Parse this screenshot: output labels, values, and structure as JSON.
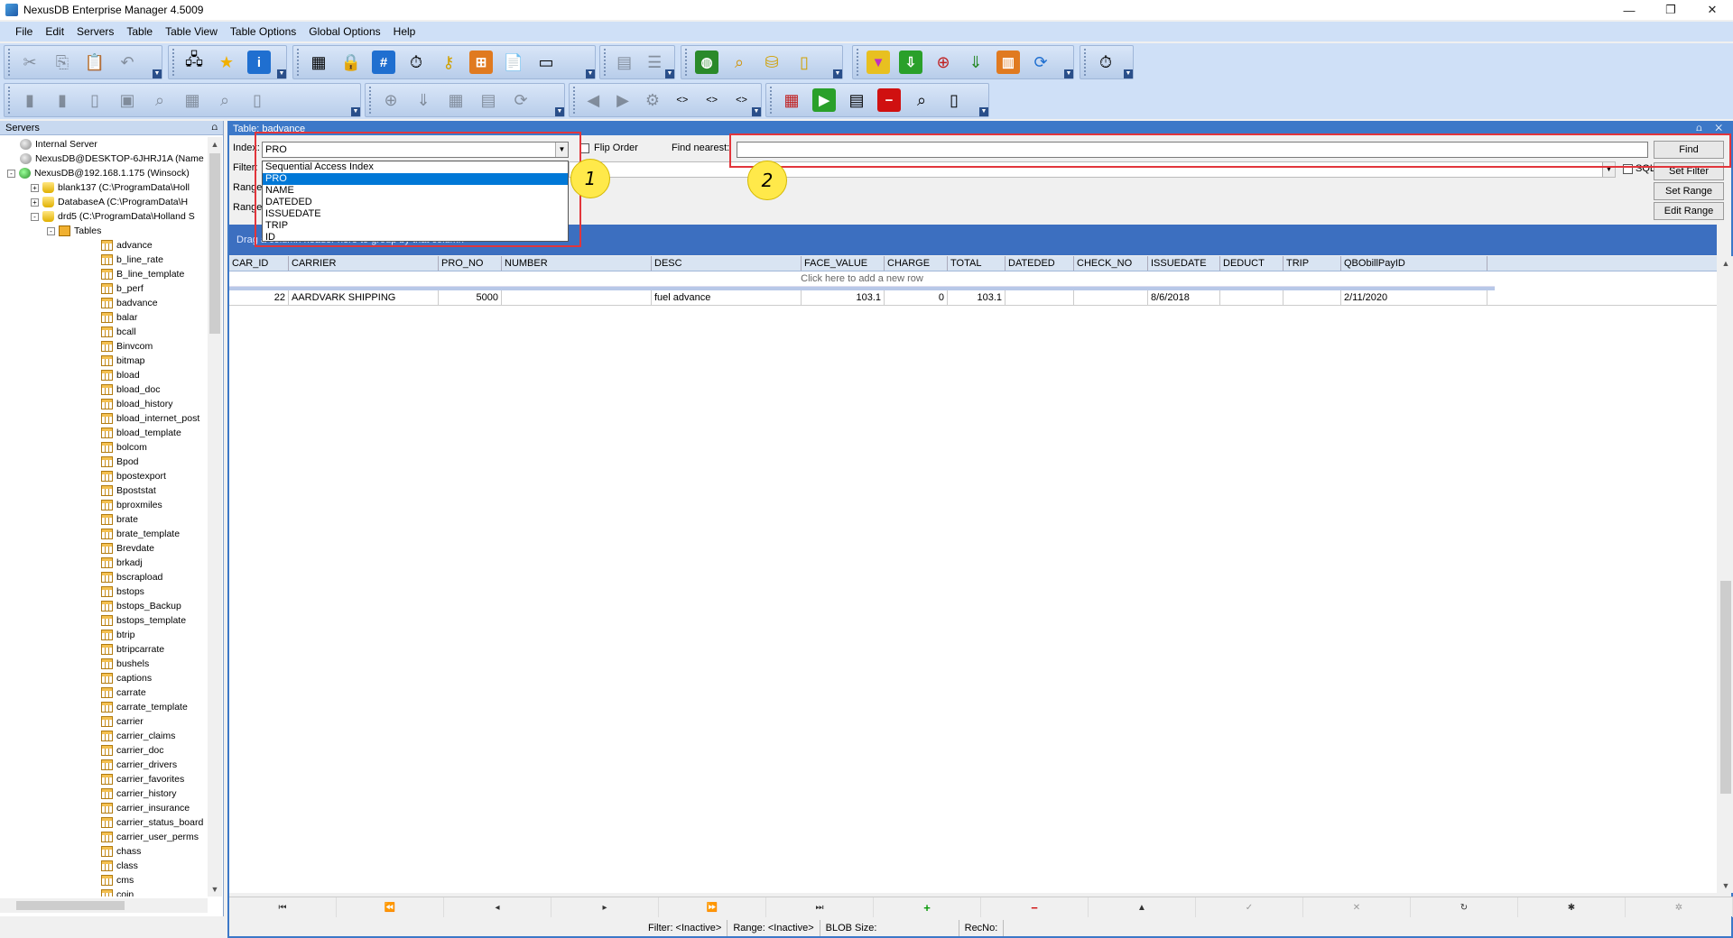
{
  "window": {
    "title": "NexusDB Enterprise Manager 4.5009",
    "minimize": "—",
    "maximize": "❐",
    "close": "✕"
  },
  "menu": [
    {
      "label": "File"
    },
    {
      "label": "Edit"
    },
    {
      "label": "Servers"
    },
    {
      "label": "Table"
    },
    {
      "label": "Table View"
    },
    {
      "label": "Table Options"
    },
    {
      "label": "Global Options"
    },
    {
      "label": "Help"
    }
  ],
  "servers_panel": {
    "title": "Servers",
    "pin": "⩍",
    "nodes": [
      {
        "label": "Internal Server",
        "icon": "server-icon",
        "level": 0
      },
      {
        "label": "NexusDB@DESKTOP-6JHRJ1A (Name",
        "icon": "server-icon",
        "level": 0
      },
      {
        "label": "NexusDB@192.168.1.175 (Winsock)",
        "icon": "server-connected-icon",
        "level": 0,
        "exp": "-"
      },
      {
        "label": "blank137 (C:\\ProgramData\\Holl",
        "icon": "database-icon",
        "level": 1,
        "exp": "+"
      },
      {
        "label": "DatabaseA (C:\\ProgramData\\H",
        "icon": "database-icon",
        "level": 1,
        "exp": "+"
      },
      {
        "label": "drd5 (C:\\ProgramData\\Holland S",
        "icon": "database-icon",
        "level": 1,
        "exp": "-"
      },
      {
        "label": "Tables",
        "icon": "tables-folder-icon",
        "level": 2,
        "exp": "-"
      }
    ],
    "tables": [
      "advance",
      "b_line_rate",
      "B_line_template",
      "b_perf",
      "badvance",
      "balar",
      "bcall",
      "Binvcom",
      "bitmap",
      "bload",
      "bload_doc",
      "bload_history",
      "bload_internet_post",
      "bload_template",
      "bolcom",
      "Bpod",
      "bpostexport",
      "Bpoststat",
      "bproxmiles",
      "brate",
      "brate_template",
      "Brevdate",
      "brkadj",
      "bscrapload",
      "bstops",
      "bstops_Backup",
      "bstops_template",
      "btrip",
      "btripcarrate",
      "bushels",
      "captions",
      "carrate",
      "carrate_template",
      "carrier",
      "carrier_claims",
      "carrier_doc",
      "carrier_drivers",
      "carrier_favorites",
      "carrier_history",
      "carrier_insurance",
      "carrier_status_board",
      "carrier_user_perms",
      "chass",
      "class",
      "cms",
      "coin"
    ]
  },
  "table_window": {
    "title": "Table: badvance",
    "wbtns": "⩍ ✕",
    "index_label": "Index:",
    "index_value": "PRO",
    "index_options": [
      "Sequential Access Index",
      "PRO",
      "NAME",
      "DATEDED",
      "ISSUEDATE",
      "TRIP",
      "ID"
    ],
    "flip_order_label": "Flip Order",
    "find_nearest_label": "Find nearest:",
    "find_value": "",
    "find_button": "Find",
    "filter_label": "Filter:",
    "sql_filter_label": "SQL Filter",
    "set_filter_button": "Set Filter",
    "range_label_1": "Range",
    "range_label_2": "Range",
    "set_range_button": "Set Range",
    "edit_range_button": "Edit Range",
    "group_band_text": "Drag a column header here to group by that column",
    "add_row_text": "Click here to add a new row",
    "columns": [
      "CAR_ID",
      "CARRIER",
      "PRO_NO",
      "NUMBER",
      "DESC",
      "FACE_VALUE",
      "CHARGE",
      "TOTAL",
      "DATEDED",
      "CHECK_NO",
      "ISSUEDATE",
      "DEDUCT",
      "TRIP",
      "QBObillPayID"
    ],
    "rows": [
      [
        "22",
        "AARDVARK SHIPPING",
        "5000",
        "",
        "fuel advance",
        "103.1",
        "0",
        "103.1",
        "",
        "",
        "8/6/2018",
        "",
        "",
        "2/11/2020"
      ]
    ],
    "nav": [
      {
        "name": "nav-first-button",
        "glyph": "⏮"
      },
      {
        "name": "nav-prior-page-button",
        "glyph": "⏪"
      },
      {
        "name": "nav-prior-button",
        "glyph": "◂"
      },
      {
        "name": "nav-next-button",
        "glyph": "▸"
      },
      {
        "name": "nav-next-page-button",
        "glyph": "⏩"
      },
      {
        "name": "nav-last-button",
        "glyph": "⏭"
      },
      {
        "name": "nav-insert-button",
        "glyph": "+"
      },
      {
        "name": "nav-delete-button",
        "glyph": "−"
      },
      {
        "name": "nav-edit-button",
        "glyph": "▲"
      },
      {
        "name": "nav-post-button",
        "glyph": "✓"
      },
      {
        "name": "nav-cancel-button",
        "glyph": "✕"
      },
      {
        "name": "nav-refresh-button",
        "glyph": "↻"
      },
      {
        "name": "nav-bookmark-button",
        "glyph": "✱"
      },
      {
        "name": "nav-goto-bookmark-button",
        "glyph": "✲"
      }
    ],
    "status": {
      "filter": "Filter: <Inactive>",
      "range": "Range: <Inactive>",
      "blob": "BLOB Size:",
      "recno": "RecNo:"
    }
  },
  "annotations": {
    "callout_1": "1",
    "callout_2": "2"
  },
  "colors": {
    "accent": "#3c78c8",
    "selection": "#0078d7",
    "annotation_red": "#e2353b",
    "callout_yellow": "#ffe94a"
  }
}
